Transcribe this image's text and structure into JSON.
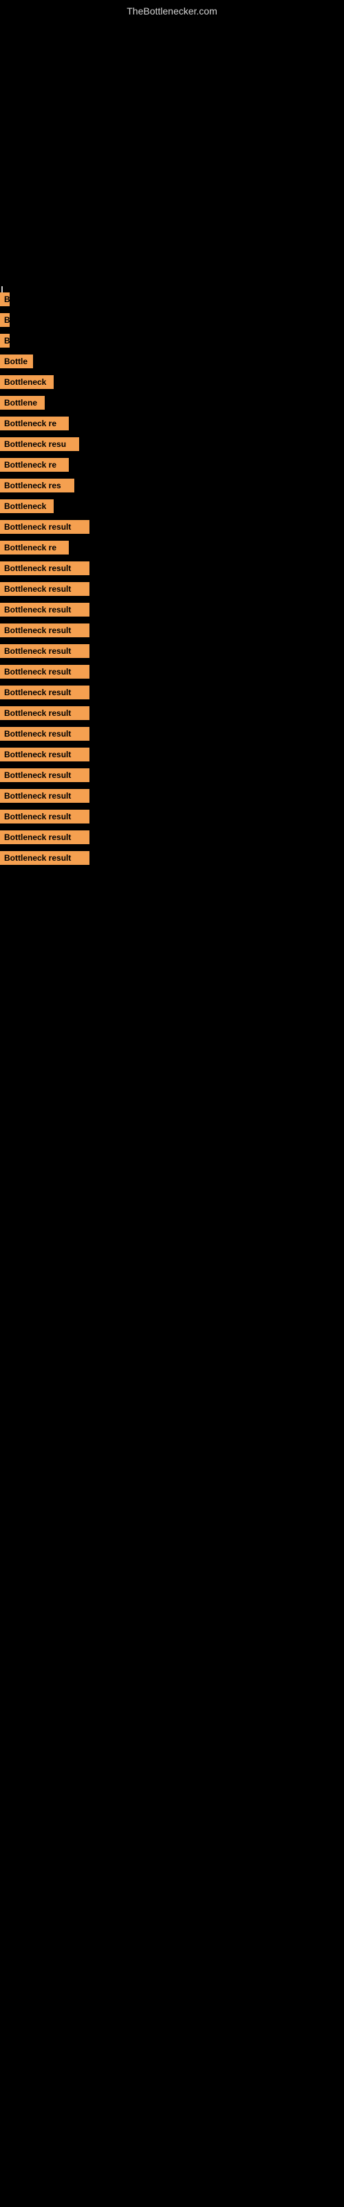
{
  "site": {
    "title": "TheBottlenecker.com"
  },
  "results": [
    {
      "label": "B",
      "width": 14
    },
    {
      "label": "B",
      "width": 14
    },
    {
      "label": "B",
      "width": 14
    },
    {
      "label": "Bottle",
      "width": 48
    },
    {
      "label": "Bottleneck",
      "width": 78
    },
    {
      "label": "Bottlene",
      "width": 65
    },
    {
      "label": "Bottleneck re",
      "width": 100
    },
    {
      "label": "Bottleneck resu",
      "width": 115
    },
    {
      "label": "Bottleneck re",
      "width": 100
    },
    {
      "label": "Bottleneck res",
      "width": 108
    },
    {
      "label": "Bottleneck",
      "width": 78
    },
    {
      "label": "Bottleneck result",
      "width": 130
    },
    {
      "label": "Bottleneck re",
      "width": 100
    },
    {
      "label": "Bottleneck result",
      "width": 130
    },
    {
      "label": "Bottleneck result",
      "width": 130
    },
    {
      "label": "Bottleneck result",
      "width": 130
    },
    {
      "label": "Bottleneck result",
      "width": 130
    },
    {
      "label": "Bottleneck result",
      "width": 130
    },
    {
      "label": "Bottleneck result",
      "width": 130
    },
    {
      "label": "Bottleneck result",
      "width": 130
    },
    {
      "label": "Bottleneck result",
      "width": 130
    },
    {
      "label": "Bottleneck result",
      "width": 130
    },
    {
      "label": "Bottleneck result",
      "width": 130
    },
    {
      "label": "Bottleneck result",
      "width": 130
    },
    {
      "label": "Bottleneck result",
      "width": 130
    },
    {
      "label": "Bottleneck result",
      "width": 130
    },
    {
      "label": "Bottleneck result",
      "width": 130
    },
    {
      "label": "Bottleneck result",
      "width": 130
    }
  ]
}
